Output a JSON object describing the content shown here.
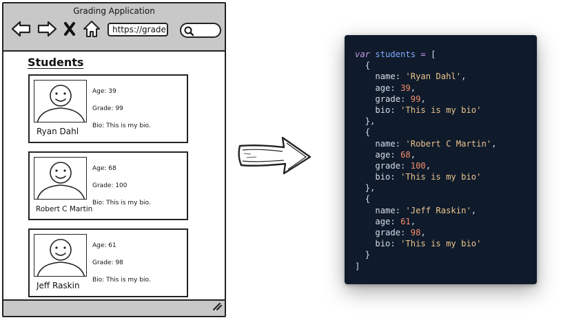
{
  "window": {
    "title": "Grading Application",
    "url": "https://grade",
    "icons": [
      "back-arrow-icon",
      "forward-arrow-icon",
      "close-x-icon",
      "home-icon",
      "search-icon",
      "resize-grip-icon"
    ]
  },
  "page": {
    "heading": "Students"
  },
  "students": [
    {
      "name": "Ryan Dahl",
      "age": "Age: 39",
      "grade": "Grade: 99",
      "bio": "Bio: This is my bio."
    },
    {
      "name": "Robert C Martin",
      "age": "Age: 68",
      "grade": "Grade: 100",
      "bio": "Bio: This is my bio."
    },
    {
      "name": "Jeff Raskin",
      "age": "Age: 61",
      "grade": "Grade: 98",
      "bio": "Bio: This is my bio."
    }
  ],
  "code": {
    "keyword": "var",
    "variable": "students",
    "operator": "=",
    "open_bracket": "[",
    "close_bracket": "]",
    "open_brace": "{",
    "close_brace": "}",
    "close_brace_comma": "},",
    "keys": {
      "name": "name:",
      "age": "age:",
      "grade": "grade:",
      "bio": "bio:"
    },
    "records": [
      {
        "name": "'Ryan Dahl'",
        "age": "39",
        "grade": "99",
        "bio": "'This is my bio'"
      },
      {
        "name": "'Robert C Martin'",
        "age": "68",
        "grade": "100",
        "bio": "'This is my bio'"
      },
      {
        "name": "'Jeff Raskin'",
        "age": "61",
        "grade": "98",
        "bio": "'This is my bio'"
      }
    ]
  },
  "colors": {
    "code_background": "#0f1b2b",
    "keyword": "#c792ea",
    "variable": "#82aaff",
    "string": "#ecc48d",
    "number": "#f78c6c",
    "toolbar_gray": "#c8c8c8"
  }
}
